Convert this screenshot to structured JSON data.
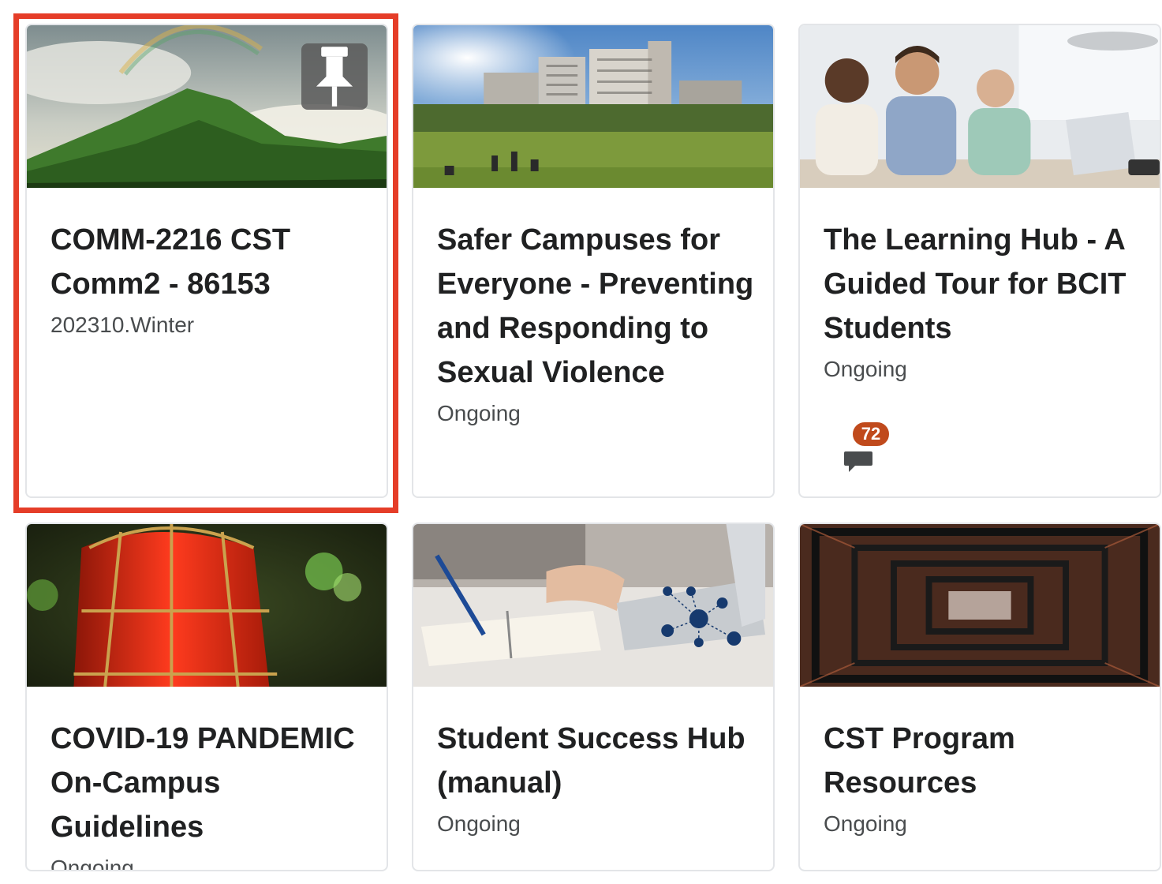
{
  "courses": [
    {
      "title": "COMM-2216 CST Comm2 - 86153",
      "subtitle": "202310.Winter",
      "image": "mountain-rainbow",
      "pinned": true
    },
    {
      "title": "Safer Campuses for Everyone - Preventing and Responding to Sexual Violence",
      "subtitle": "Ongoing",
      "image": "campus-buildings"
    },
    {
      "title": "The Learning Hub - A Guided Tour for BCIT Students",
      "subtitle": "Ongoing",
      "image": "students-laptops",
      "notification_count": "72"
    },
    {
      "title": "COVID-19 PANDEMIC On-Campus Guidelines",
      "subtitle": "Ongoing",
      "image": "red-alarm-light"
    },
    {
      "title": "Student Success Hub (manual)",
      "subtitle": "Ongoing",
      "image": "notebook-laptop"
    },
    {
      "title": "CST Program Resources",
      "subtitle": "Ongoing",
      "image": "steel-structure"
    }
  ],
  "icons": {
    "pin": "pin-icon",
    "discussion": "chat-bubble-icon"
  },
  "colors": {
    "highlight": "#e53d28",
    "badge": "#c04a1c",
    "card_border": "#e3e5e8"
  }
}
